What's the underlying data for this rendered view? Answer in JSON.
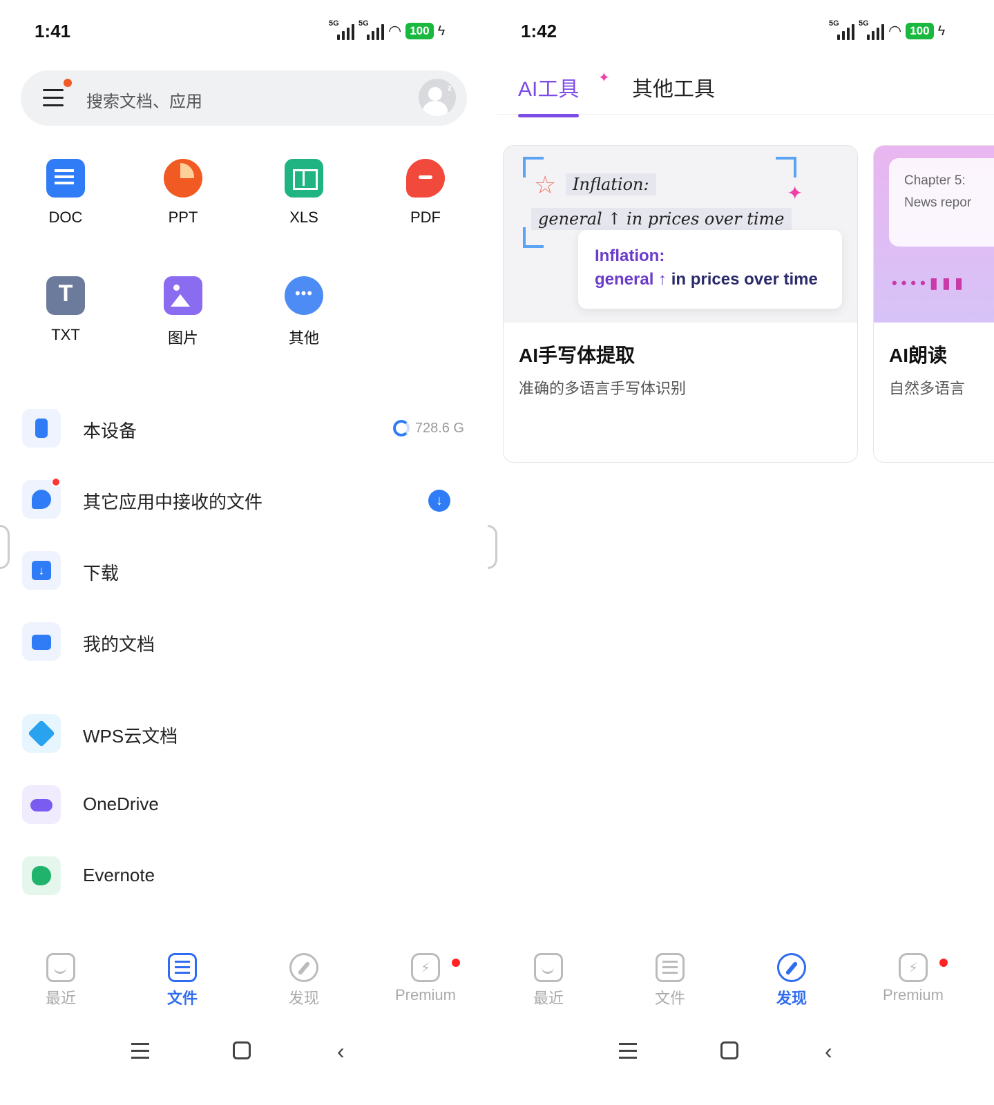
{
  "left": {
    "status": {
      "time": "1:41",
      "battery": "100",
      "network_label": "5G"
    },
    "search": {
      "placeholder": "搜索文档、应用"
    },
    "file_types": [
      {
        "label": "DOC",
        "icon": "doc-icon"
      },
      {
        "label": "PPT",
        "icon": "ppt-icon"
      },
      {
        "label": "XLS",
        "icon": "xls-icon"
      },
      {
        "label": "PDF",
        "icon": "pdf-icon"
      },
      {
        "label": "TXT",
        "icon": "txt-icon"
      },
      {
        "label": "图片",
        "icon": "image-icon"
      },
      {
        "label": "其他",
        "icon": "more-icon"
      }
    ],
    "locations": [
      {
        "label": "本设备",
        "meta": "728.6 G",
        "icon": "phone-icon",
        "color": "#2f7cf6"
      },
      {
        "label": "其它应用中接收的文件",
        "icon": "satellite-icon",
        "color": "#2f7cf6"
      },
      {
        "label": "下载",
        "icon": "download-icon",
        "color": "#2f7cf6"
      },
      {
        "label": "我的文档",
        "icon": "folder-icon",
        "color": "#2f7cf6"
      },
      {
        "label": "WPS云文档",
        "icon": "cloud-box-icon",
        "color": "#29a3f0"
      },
      {
        "label": "OneDrive",
        "icon": "onedrive-icon",
        "color": "#7a5cf0"
      },
      {
        "label": "Evernote",
        "icon": "evernote-icon",
        "color": "#1fb36b"
      }
    ],
    "nav": [
      {
        "label": "最近",
        "icon": "recent-icon"
      },
      {
        "label": "文件",
        "icon": "files-icon",
        "active": true
      },
      {
        "label": "发现",
        "icon": "discover-icon"
      },
      {
        "label": "Premium",
        "icon": "premium-icon"
      }
    ]
  },
  "right": {
    "status": {
      "time": "1:42",
      "battery": "100",
      "network_label": "5G"
    },
    "tabs": [
      {
        "label": "AI工具",
        "active": true
      },
      {
        "label": "其他工具"
      }
    ],
    "cards": [
      {
        "title": "AI手写体提取",
        "subtitle": "准确的多语言手写体识别",
        "art": {
          "handwriting_line1": "Inflation:",
          "handwriting_line2": "general ↑ in prices over time",
          "result_line1": "Inflation:",
          "result_line2_a": "general ↑",
          "result_line2_b": " in prices over time"
        }
      },
      {
        "title": "AI朗读",
        "subtitle": "自然多语言",
        "art": {
          "chapter": "Chapter 5:",
          "subline": "News repor"
        }
      }
    ],
    "nav": [
      {
        "label": "最近",
        "icon": "recent-icon"
      },
      {
        "label": "文件",
        "icon": "files-icon"
      },
      {
        "label": "发现",
        "icon": "discover-icon",
        "active": true
      },
      {
        "label": "Premium",
        "icon": "premium-icon"
      }
    ]
  },
  "colors": {
    "accent_blue": "#2f6cf0",
    "accent_purple": "#7d4be6",
    "battery_green": "#19b83e"
  }
}
